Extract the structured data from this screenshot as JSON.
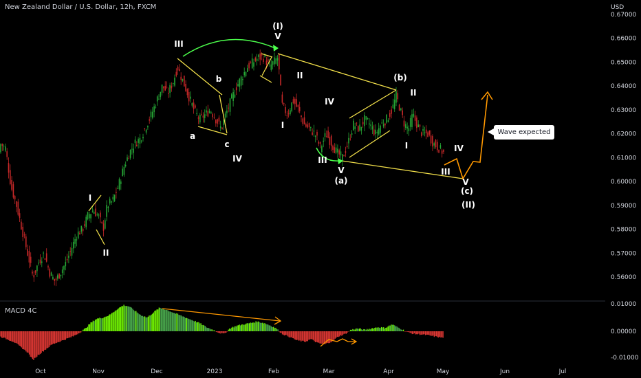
{
  "header": {
    "title": "New Zealand Dollar / U.S. Dollar, 12h, FXCM",
    "currency": "USD"
  },
  "macd_panel": {
    "title": "MACD 4C"
  },
  "callout": {
    "text": "Wave expected"
  },
  "colors": {
    "background": "#000000",
    "up": "#26a635",
    "down": "#c62828",
    "macd_up": "#4caf50",
    "macd_up_bright": "#76ff03",
    "macd_down": "#e53935",
    "trend_line": "#f2e04a",
    "projection": "#ff9800",
    "arc": "#4cff4c",
    "text": "#d1d4dc"
  },
  "chart_data": [
    {
      "type": "candlestick",
      "ylim": [
        0.552,
        0.673
      ],
      "yticks": [
        "0.56000",
        "0.57000",
        "0.58000",
        "0.59000",
        "0.60000",
        "0.61000",
        "0.62000",
        "0.63000",
        "0.64000",
        "0.65000",
        "0.66000",
        "0.67000"
      ],
      "xticks": [
        "Oct",
        "Nov",
        "Dec",
        "2023",
        "Feb",
        "Mar",
        "Apr",
        "May",
        "Jun",
        "Jul"
      ],
      "path": [
        [
          0,
          0.616
        ],
        [
          8,
          0.614
        ],
        [
          16,
          0.598
        ],
        [
          24,
          0.59
        ],
        [
          32,
          0.58
        ],
        [
          40,
          0.57
        ],
        [
          48,
          0.56
        ],
        [
          56,
          0.566
        ],
        [
          64,
          0.57
        ],
        [
          72,
          0.562
        ],
        [
          80,
          0.558
        ],
        [
          88,
          0.562
        ],
        [
          96,
          0.566
        ],
        [
          104,
          0.572
        ],
        [
          112,
          0.578
        ],
        [
          120,
          0.58
        ],
        [
          128,
          0.586
        ],
        [
          136,
          0.588
        ],
        [
          144,
          0.585
        ],
        [
          150,
          0.58
        ],
        [
          156,
          0.59
        ],
        [
          164,
          0.592
        ],
        [
          172,
          0.598
        ],
        [
          180,
          0.606
        ],
        [
          188,
          0.612
        ],
        [
          196,
          0.616
        ],
        [
          204,
          0.618
        ],
        [
          212,
          0.623
        ],
        [
          220,
          0.628
        ],
        [
          228,
          0.634
        ],
        [
          236,
          0.64
        ],
        [
          244,
          0.637
        ],
        [
          252,
          0.642
        ],
        [
          258,
          0.648
        ],
        [
          266,
          0.642
        ],
        [
          274,
          0.636
        ],
        [
          282,
          0.63
        ],
        [
          290,
          0.626
        ],
        [
          298,
          0.628
        ],
        [
          306,
          0.63
        ],
        [
          314,
          0.626
        ],
        [
          322,
          0.622
        ],
        [
          328,
          0.628
        ],
        [
          336,
          0.634
        ],
        [
          344,
          0.64
        ],
        [
          352,
          0.644
        ],
        [
          360,
          0.648
        ],
        [
          368,
          0.65
        ],
        [
          376,
          0.652
        ],
        [
          384,
          0.652
        ],
        [
          392,
          0.648
        ],
        [
          398,
          0.65
        ],
        [
          404,
          0.652
        ],
        [
          410,
          0.632
        ],
        [
          418,
          0.628
        ],
        [
          426,
          0.634
        ],
        [
          434,
          0.63
        ],
        [
          442,
          0.624
        ],
        [
          450,
          0.622
        ],
        [
          458,
          0.62
        ],
        [
          466,
          0.614
        ],
        [
          474,
          0.62
        ],
        [
          482,
          0.616
        ],
        [
          490,
          0.612
        ],
        [
          498,
          0.61
        ],
        [
          506,
          0.616
        ],
        [
          514,
          0.624
        ],
        [
          522,
          0.622
        ],
        [
          530,
          0.626
        ],
        [
          538,
          0.624
        ],
        [
          546,
          0.62
        ],
        [
          554,
          0.624
        ],
        [
          562,
          0.626
        ],
        [
          570,
          0.63
        ],
        [
          576,
          0.636
        ],
        [
          582,
          0.63
        ],
        [
          588,
          0.624
        ],
        [
          594,
          0.622
        ],
        [
          600,
          0.628
        ],
        [
          606,
          0.624
        ],
        [
          614,
          0.62
        ],
        [
          622,
          0.62
        ],
        [
          630,
          0.616
        ],
        [
          638,
          0.614
        ],
        [
          645,
          0.612
        ]
      ]
    },
    {
      "type": "bar",
      "series_name": "MACD 4C",
      "ylim": [
        -0.013,
        0.011
      ],
      "yticks": [
        "0.01000",
        "0.00000",
        "-0.01000"
      ],
      "path": [
        [
          0,
          -0.002
        ],
        [
          10,
          -0.003
        ],
        [
          20,
          -0.004
        ],
        [
          30,
          -0.006
        ],
        [
          40,
          -0.008
        ],
        [
          48,
          -0.011
        ],
        [
          56,
          -0.009
        ],
        [
          66,
          -0.007
        ],
        [
          76,
          -0.005
        ],
        [
          86,
          -0.004
        ],
        [
          96,
          -0.003
        ],
        [
          106,
          -0.002
        ],
        [
          116,
          -0.0005
        ],
        [
          124,
          0.001
        ],
        [
          132,
          0.003
        ],
        [
          140,
          0.0045
        ],
        [
          150,
          0.005
        ],
        [
          160,
          0.006
        ],
        [
          170,
          0.008
        ],
        [
          180,
          0.0095
        ],
        [
          188,
          0.009
        ],
        [
          196,
          0.0075
        ],
        [
          204,
          0.006
        ],
        [
          214,
          0.005
        ],
        [
          224,
          0.007
        ],
        [
          232,
          0.0085
        ],
        [
          240,
          0.008
        ],
        [
          250,
          0.007
        ],
        [
          260,
          0.006
        ],
        [
          270,
          0.005
        ],
        [
          280,
          0.004
        ],
        [
          290,
          0.003
        ],
        [
          300,
          0.0015
        ],
        [
          310,
          0.0005
        ],
        [
          318,
          -0.0005
        ],
        [
          326,
          -0.001
        ],
        [
          334,
          0.001
        ],
        [
          344,
          0.002
        ],
        [
          354,
          0.0025
        ],
        [
          364,
          0.003
        ],
        [
          374,
          0.0035
        ],
        [
          384,
          0.003
        ],
        [
          394,
          0.002
        ],
        [
          402,
          0.001
        ],
        [
          410,
          -0.001
        ],
        [
          420,
          -0.002
        ],
        [
          432,
          -0.0035
        ],
        [
          444,
          -0.004
        ],
        [
          452,
          -0.003
        ],
        [
          462,
          -0.0045
        ],
        [
          472,
          -0.005
        ],
        [
          482,
          -0.004
        ],
        [
          492,
          -0.002
        ],
        [
          502,
          -0.001
        ],
        [
          510,
          0.0005
        ],
        [
          520,
          0.001
        ],
        [
          530,
          0.0005
        ],
        [
          540,
          0.001
        ],
        [
          550,
          0.0015
        ],
        [
          560,
          0.0012
        ],
        [
          570,
          0.0025
        ],
        [
          578,
          0.0015
        ],
        [
          586,
          0.0005
        ],
        [
          594,
          -0.0005
        ],
        [
          602,
          -0.001
        ],
        [
          612,
          -0.0012
        ],
        [
          622,
          -0.0015
        ],
        [
          632,
          -0.002
        ],
        [
          645,
          -0.0025
        ]
      ]
    }
  ],
  "annotations": {
    "wave_labels": [
      {
        "text": "I",
        "x": 131,
        "y": 292
      },
      {
        "text": "II",
        "x": 154,
        "y": 372
      },
      {
        "text": "III",
        "x": 260,
        "y": 68
      },
      {
        "text": "a",
        "x": 280,
        "y": 202
      },
      {
        "text": "b",
        "x": 318,
        "y": 119
      },
      {
        "text": "c",
        "x": 330,
        "y": 214
      },
      {
        "text": "IV",
        "x": 345,
        "y": 235
      },
      {
        "text": "(I)",
        "x": 404,
        "y": 42
      },
      {
        "text": "V",
        "x": 404,
        "y": 57
      },
      {
        "text": "I",
        "x": 411,
        "y": 186
      },
      {
        "text": "II",
        "x": 436,
        "y": 114
      },
      {
        "text": "IV",
        "x": 479,
        "y": 152
      },
      {
        "text": "III",
        "x": 469,
        "y": 237
      },
      {
        "text": "V",
        "x": 496,
        "y": 252
      },
      {
        "text": "(a)",
        "x": 496,
        "y": 267
      },
      {
        "text": "(b)",
        "x": 582,
        "y": 117
      },
      {
        "text": "II",
        "x": 601,
        "y": 139
      },
      {
        "text": "I",
        "x": 591,
        "y": 216
      },
      {
        "text": "IV",
        "x": 667,
        "y": 220
      },
      {
        "text": "III",
        "x": 648,
        "y": 254
      },
      {
        "text": "V",
        "x": 677,
        "y": 269
      },
      {
        "text": "(c)",
        "x": 679,
        "y": 282
      },
      {
        "text": "(II)",
        "x": 681,
        "y": 302
      }
    ]
  }
}
